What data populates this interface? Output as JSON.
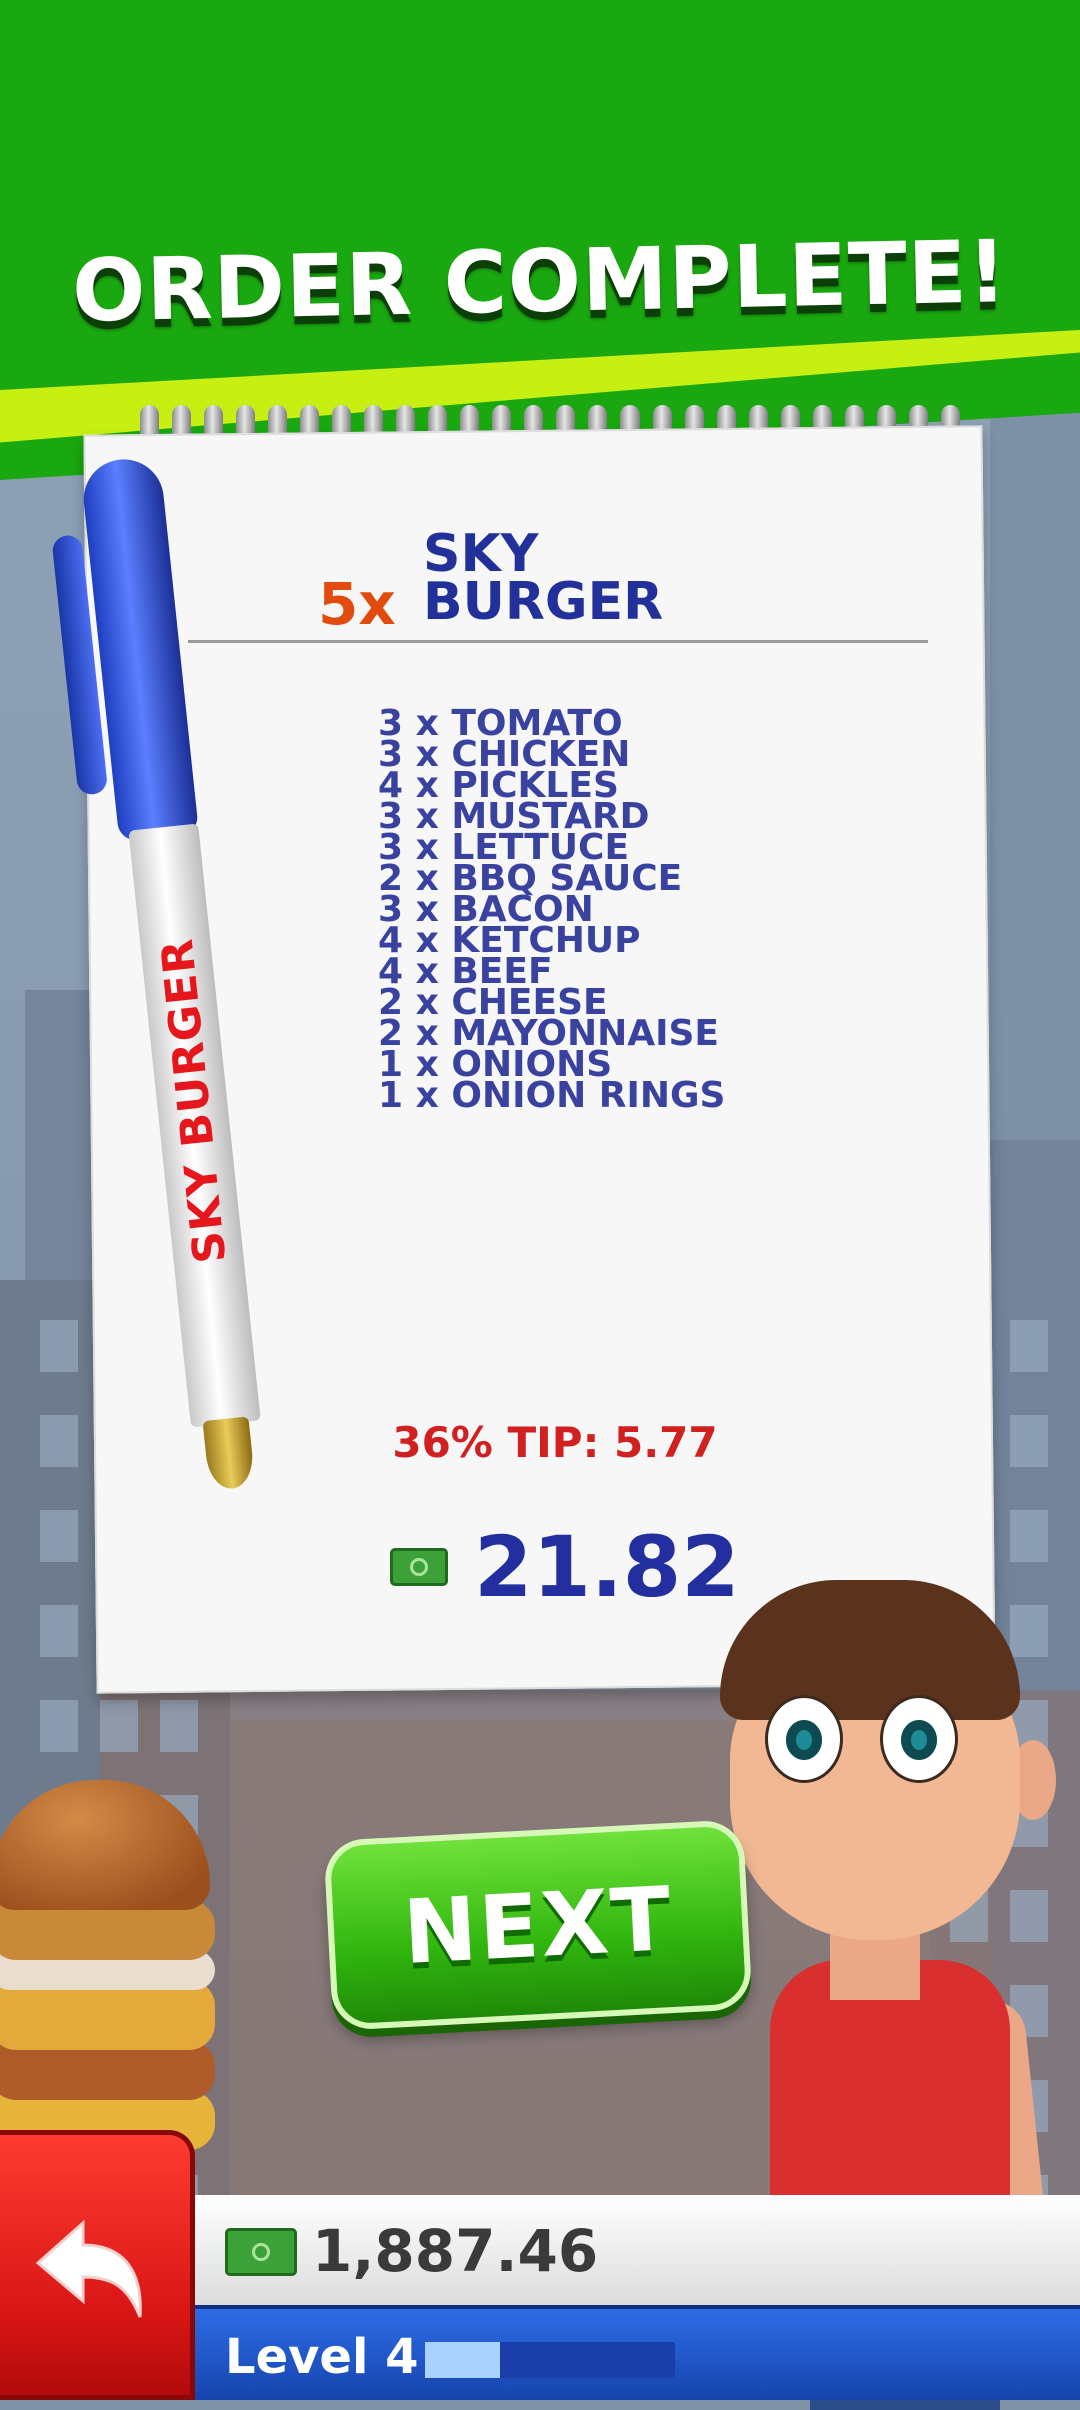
{
  "header": {
    "title": "ORDER COMPLETE!"
  },
  "order": {
    "quantity": "5x",
    "product_name": "SKY BURGER",
    "ingredients": [
      "3 x TOMATO",
      "3 x CHICKEN",
      "4 x PICKLES",
      "3 x MUSTARD",
      "3 x LETTUCE",
      "2 x BBQ SAUCE",
      "3 x BACON",
      "4 x KETCHUP",
      "4 x BEEF",
      "2 x CHEESE",
      "2 x MAYONNAISE",
      "1 x ONIONS",
      "1 x ONION RINGS"
    ],
    "tip": "36% TIP: 5.77",
    "total": "21.82"
  },
  "pen": {
    "brand": "SKY BURGER"
  },
  "buttons": {
    "next": "NEXT"
  },
  "wallet": {
    "balance": "1,887.46"
  },
  "level": {
    "label": "Level 4",
    "progress_fraction": 0.3
  },
  "colors": {
    "header_green": "#19a80f",
    "accent_yellow": "#c8ef12",
    "ink_blue": "#22319a",
    "tip_red": "#d02020",
    "qty_orange": "#e24b0e"
  },
  "icons": {
    "cash": "cash-icon",
    "back": "back-arrow-icon"
  }
}
